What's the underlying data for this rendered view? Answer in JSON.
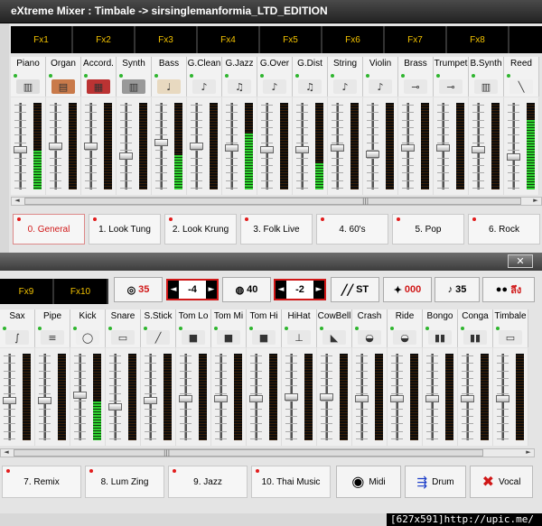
{
  "window": {
    "title": "eXtreme Mixer  : Timbale -> sirsinglemanformia_LTD_EDITION"
  },
  "top": {
    "fx": [
      "Fx1",
      "Fx2",
      "Fx3",
      "Fx4",
      "Fx5",
      "Fx6",
      "Fx7",
      "Fx8"
    ],
    "instruments": [
      {
        "name": "Piano",
        "icon": "piano-icon",
        "level": 0.45,
        "knob": 0.55
      },
      {
        "name": "Organ",
        "icon": "organ-icon",
        "level": 0.0,
        "knob": 0.5
      },
      {
        "name": "Accord.",
        "icon": "accordion-icon",
        "level": 0.0,
        "knob": 0.5
      },
      {
        "name": "Synth",
        "icon": "synth-icon",
        "level": 0.0,
        "knob": 0.62
      },
      {
        "name": "Bass",
        "icon": "bass-icon",
        "level": 0.4,
        "knob": 0.45
      },
      {
        "name": "G.Clean",
        "icon": "guitar-clean-icon",
        "level": 0.0,
        "knob": 0.5
      },
      {
        "name": "G.Jazz",
        "icon": "guitar-jazz-icon",
        "level": 0.65,
        "knob": 0.52
      },
      {
        "name": "G.Over",
        "icon": "guitar-over-icon",
        "level": 0.0,
        "knob": 0.54
      },
      {
        "name": "G.Dist",
        "icon": "guitar-dist-icon",
        "level": 0.3,
        "knob": 0.55
      },
      {
        "name": "String",
        "icon": "violin-icon",
        "level": 0.0,
        "knob": 0.52
      },
      {
        "name": "Violin",
        "icon": "violin-icon",
        "level": 0.0,
        "knob": 0.6
      },
      {
        "name": "Brass",
        "icon": "trombone-icon",
        "level": 0.0,
        "knob": 0.52
      },
      {
        "name": "Trumpet",
        "icon": "trumpet-icon",
        "level": 0.0,
        "knob": 0.52
      },
      {
        "name": "B.Synth",
        "icon": "keyboard-icon",
        "level": 0.0,
        "knob": 0.54
      },
      {
        "name": "Reed",
        "icon": "clarinet-icon",
        "level": 0.8,
        "knob": 0.64
      }
    ],
    "tabs": [
      {
        "label": "0. General",
        "selected": true
      },
      {
        "label": "1. Look Tung"
      },
      {
        "label": "2. Look Krung"
      },
      {
        "label": "3. Folk Live"
      },
      {
        "label": "4. 60's"
      },
      {
        "label": "5. Pop"
      },
      {
        "label": "6. Rock"
      }
    ]
  },
  "bottom": {
    "close": "✕",
    "fx": [
      "Fx9",
      "Fx10"
    ],
    "controls": {
      "c1": "35",
      "c2": "-4",
      "c3": "40",
      "c4": "-2",
      "c5": "ST",
      "c6": "000",
      "c7": "35",
      "c8": "ลึง"
    },
    "instruments": [
      {
        "name": "Sax",
        "icon": "sax-icon",
        "level": 0.0,
        "knob": 0.55
      },
      {
        "name": "Pipe",
        "icon": "pipe-icon",
        "level": 0.0,
        "knob": 0.55
      },
      {
        "name": "Kick",
        "icon": "kick-drum-icon",
        "level": 0.45,
        "knob": 0.48
      },
      {
        "name": "Snare",
        "icon": "snare-icon",
        "level": 0.0,
        "knob": 0.62
      },
      {
        "name": "S.Stick",
        "icon": "sticks-icon",
        "level": 0.0,
        "knob": 0.55
      },
      {
        "name": "Tom Lo",
        "icon": "tom-icon",
        "level": 0.0,
        "knob": 0.52
      },
      {
        "name": "Tom Mi",
        "icon": "tom-icon",
        "level": 0.0,
        "knob": 0.52
      },
      {
        "name": "Tom Hi",
        "icon": "tom-icon",
        "level": 0.0,
        "knob": 0.52
      },
      {
        "name": "HiHat",
        "icon": "hihat-icon",
        "level": 0.0,
        "knob": 0.5
      },
      {
        "name": "CowBell",
        "icon": "cowbell-icon",
        "level": 0.0,
        "knob": 0.5
      },
      {
        "name": "Crash",
        "icon": "cymbal-icon",
        "level": 0.0,
        "knob": 0.52
      },
      {
        "name": "Ride",
        "icon": "cymbal-icon",
        "level": 0.0,
        "knob": 0.52
      },
      {
        "name": "Bongo",
        "icon": "bongo-icon",
        "level": 0.0,
        "knob": 0.52
      },
      {
        "name": "Conga",
        "icon": "conga-icon",
        "level": 0.0,
        "knob": 0.52
      },
      {
        "name": "Timbale",
        "icon": "timbale-icon",
        "level": 0.0,
        "knob": 0.52
      }
    ],
    "tabs": [
      {
        "label": "7. Remix"
      },
      {
        "label": "8. Lum Zing"
      },
      {
        "label": "9. Jazz"
      },
      {
        "label": "10. Thai Music"
      }
    ],
    "buttons": {
      "midi": "Midi",
      "drum": "Drum",
      "vocal": "Vocal"
    }
  },
  "watermark": "[627x591]http://upic.me/",
  "colors": {
    "fx_text": "#f2c200",
    "accent_red": "#d01818",
    "meter_green": "#2fd12f"
  }
}
